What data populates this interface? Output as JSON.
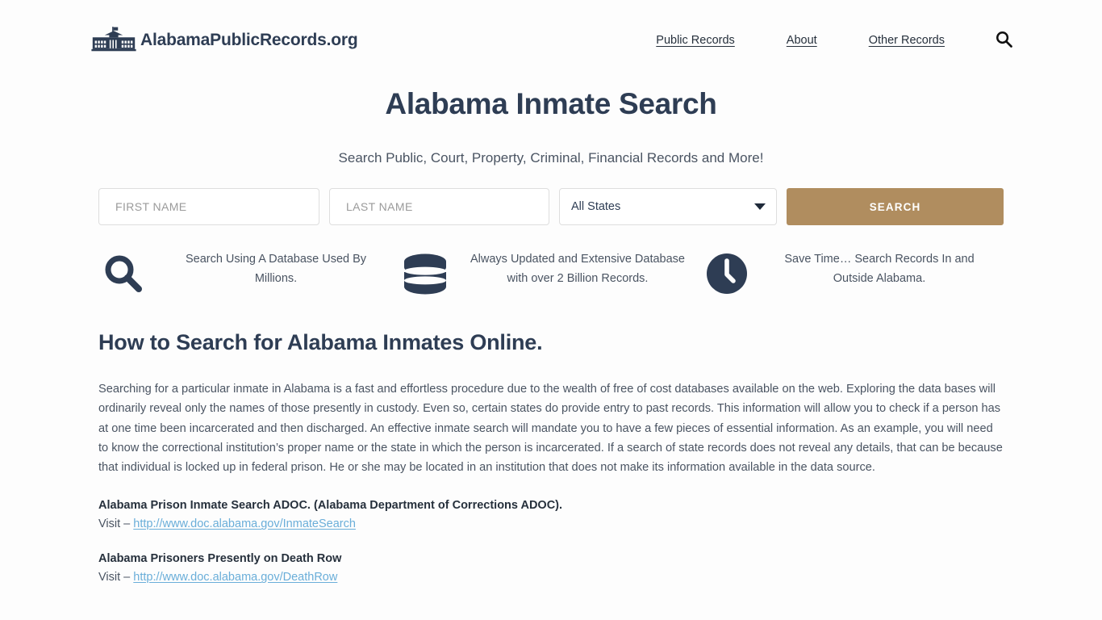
{
  "header": {
    "brand_name": "AlabamaPublicRecords.org",
    "brand_icon": "capitol-building-icon",
    "nav": [
      {
        "label": "Public Records"
      },
      {
        "label": "About"
      },
      {
        "label": "Other Records"
      }
    ],
    "search_icon": "search-icon"
  },
  "hero": {
    "title": "Alabama Inmate Search",
    "subtitle": "Search Public, Court, Property, Criminal, Financial Records and More!"
  },
  "search_form": {
    "first_name_placeholder": "FIRST NAME",
    "first_name_value": "",
    "last_name_placeholder": "LAST NAME",
    "last_name_value": "",
    "state_selected": "All States",
    "state_options": [
      "All States"
    ],
    "submit_label": "SEARCH",
    "submit_color": "#b08d5f"
  },
  "features": [
    {
      "icon": "search-icon",
      "text": "Search Using A Database Used By Millions."
    },
    {
      "icon": "database-icon",
      "text": "Always Updated and Extensive Database with over 2 Billion Records."
    },
    {
      "icon": "clock-icon",
      "text": "Save Time… Search Records In and Outside Alabama."
    }
  ],
  "article": {
    "heading": "How to Search for Alabama Inmates Online.",
    "paragraph": "Searching for a particular inmate in Alabama is a fast and effortless procedure due to the wealth of free of cost databases available on the web. Exploring the data bases will ordinarily reveal only the names of those presently in custody. Even so, certain states do provide entry to past records. This information will allow you to check if a person has at one time been incarcerated and then discharged. An effective inmate search will mandate you to have a few pieces of essential information. As an example, you will need to know the correctional institution’s proper name or the state in which the person is incarcerated. If a search of state records does not reveal any details, that can be because that individual is locked up in federal prison. He or she may be located in an institution that does not make its information available in the data source.",
    "resources": [
      {
        "title": "Alabama Prison Inmate Search ADOC. (Alabama Department of Corrections ADOC).",
        "visit_label": "Visit –",
        "link": "http://www.doc.alabama.gov/InmateSearch"
      },
      {
        "title": "Alabama Prisoners Presently on Death Row",
        "visit_label": "Visit –",
        "link": "http://www.doc.alabama.gov/DeathRow"
      }
    ]
  },
  "colors": {
    "navy": "#2e3d54",
    "body_text": "#4a5462",
    "link_blue": "#6aaed9",
    "accent_tan": "#b08d5f"
  }
}
